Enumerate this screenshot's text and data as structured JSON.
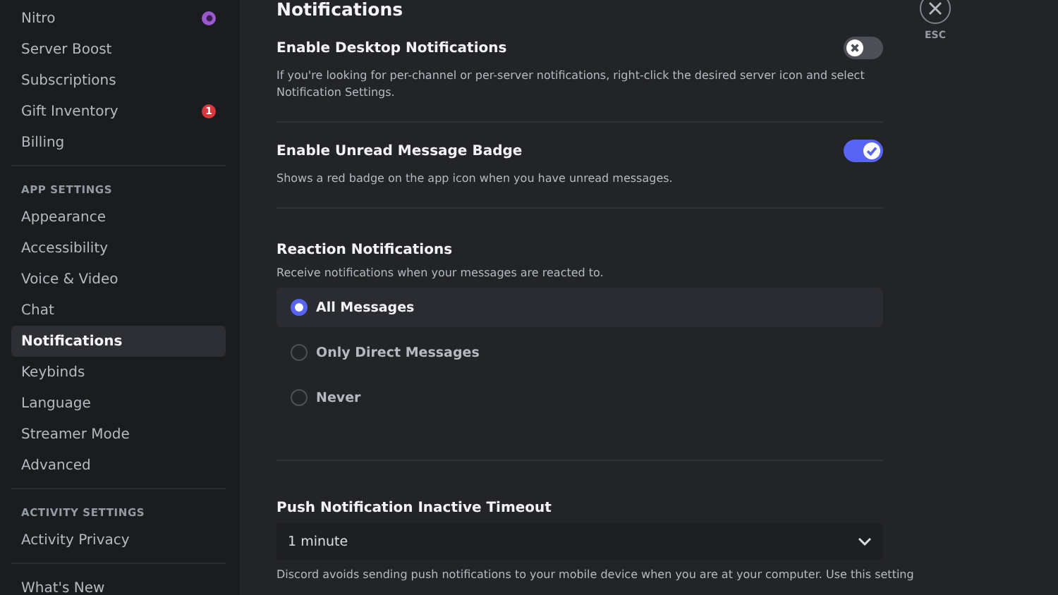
{
  "sidebar": {
    "sections": [
      {
        "items": [
          {
            "label": "Nitro",
            "selected": false,
            "trailing": {
              "kind": "nitro"
            }
          },
          {
            "label": "Server Boost",
            "selected": false
          },
          {
            "label": "Subscriptions",
            "selected": false
          },
          {
            "label": "Gift Inventory",
            "selected": false,
            "trailing": {
              "kind": "count",
              "text": "1"
            }
          },
          {
            "label": "Billing",
            "selected": false
          }
        ]
      },
      {
        "header": "APP SETTINGS",
        "items": [
          {
            "label": "Appearance",
            "selected": false
          },
          {
            "label": "Accessibility",
            "selected": false
          },
          {
            "label": "Voice & Video",
            "selected": false
          },
          {
            "label": "Chat",
            "selected": false
          },
          {
            "label": "Notifications",
            "selected": true
          },
          {
            "label": "Keybinds",
            "selected": false
          },
          {
            "label": "Language",
            "selected": false
          },
          {
            "label": "Streamer Mode",
            "selected": false
          },
          {
            "label": "Advanced",
            "selected": false
          }
        ]
      },
      {
        "header": "ACTIVITY SETTINGS",
        "items": [
          {
            "label": "Activity Privacy",
            "selected": false
          }
        ]
      },
      {
        "items": [
          {
            "label": "What's New",
            "selected": false
          }
        ]
      }
    ]
  },
  "page_title": "Notifications",
  "toggles": [
    {
      "title": "Enable Desktop Notifications",
      "on": false,
      "description": "If you're looking for per-channel or per-server notifications, right-click the desired server icon and select Notification Settings."
    },
    {
      "title": "Enable Unread Message Badge",
      "on": true,
      "description": "Shows a red badge on the app icon when you have unread messages."
    }
  ],
  "reaction": {
    "title": "Reaction Notifications",
    "description": "Receive notifications when your messages are reacted to.",
    "options": [
      {
        "label": "All Messages",
        "selected": true
      },
      {
        "label": "Only Direct Messages",
        "selected": false
      },
      {
        "label": "Never",
        "selected": false
      }
    ]
  },
  "push": {
    "title": "Push Notification Inactive Timeout",
    "value": "1 minute",
    "description": "Discord avoids sending push notifications to your mobile device when you are at your computer. Use this setting"
  },
  "close": {
    "label": "ESC"
  }
}
